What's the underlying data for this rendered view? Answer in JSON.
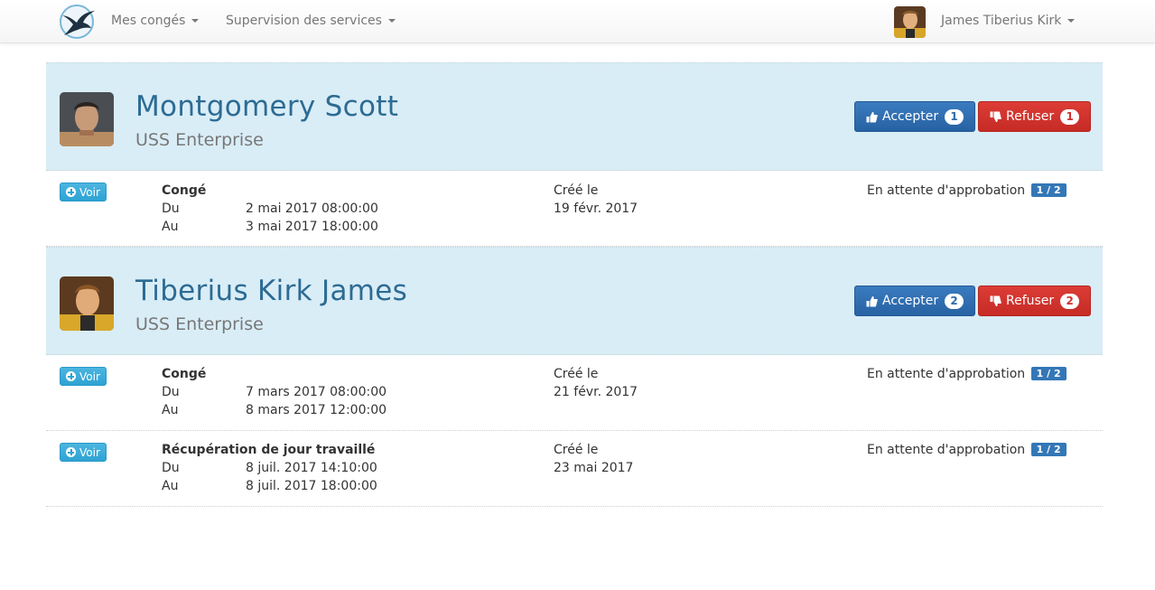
{
  "navbar": {
    "menu_conges": "Mes congés",
    "menu_supervision": "Supervision des services",
    "user_name": "James Tiberius Kirk"
  },
  "employees": [
    {
      "name": "Montgomery Scott",
      "service": "USS Enterprise",
      "accept_label": "Accepter",
      "accept_count": "1",
      "refuse_label": "Refuser",
      "refuse_count": "1",
      "requests": [
        {
          "voir": "Voir",
          "type": "Congé",
          "from_label": "Du",
          "from_value": "2 mai 2017 08:00:00",
          "to_label": "Au",
          "to_value": "3 mai 2017 18:00:00",
          "created_label": "Créé le",
          "created_value": "19 févr. 2017",
          "status": "En attente d'approbation",
          "status_badge": "1 / 2"
        }
      ]
    },
    {
      "name": "Tiberius Kirk James",
      "service": "USS Enterprise",
      "accept_label": "Accepter",
      "accept_count": "2",
      "refuse_label": "Refuser",
      "refuse_count": "2",
      "requests": [
        {
          "voir": "Voir",
          "type": "Congé",
          "from_label": "Du",
          "from_value": "7 mars 2017 08:00:00",
          "to_label": "Au",
          "to_value": "8 mars 2017 12:00:00",
          "created_label": "Créé le",
          "created_value": "21 févr. 2017",
          "status": "En attente d'approbation",
          "status_badge": "1 / 2"
        },
        {
          "voir": "Voir",
          "type": "Récupération de jour travaillé",
          "from_label": "Du",
          "from_value": "8 juil. 2017 14:10:00",
          "to_label": "Au",
          "to_value": "8 juil. 2017 18:00:00",
          "created_label": "Créé le",
          "created_value": "23 mai 2017",
          "status": "En attente d'approbation",
          "status_badge": "1 / 2"
        }
      ]
    }
  ],
  "colors": {
    "employee_header_bg": "#d9edf7",
    "name_color": "#2d6b93",
    "accept": "#2d6aa8",
    "refuse": "#cf3230",
    "voir": "#2ea3d3",
    "status_badge": "#3477b7"
  },
  "icons": [
    "swallow-logo-icon",
    "caret-down-icon",
    "thumbs-up-icon",
    "thumbs-down-icon",
    "plus-circle-icon"
  ]
}
